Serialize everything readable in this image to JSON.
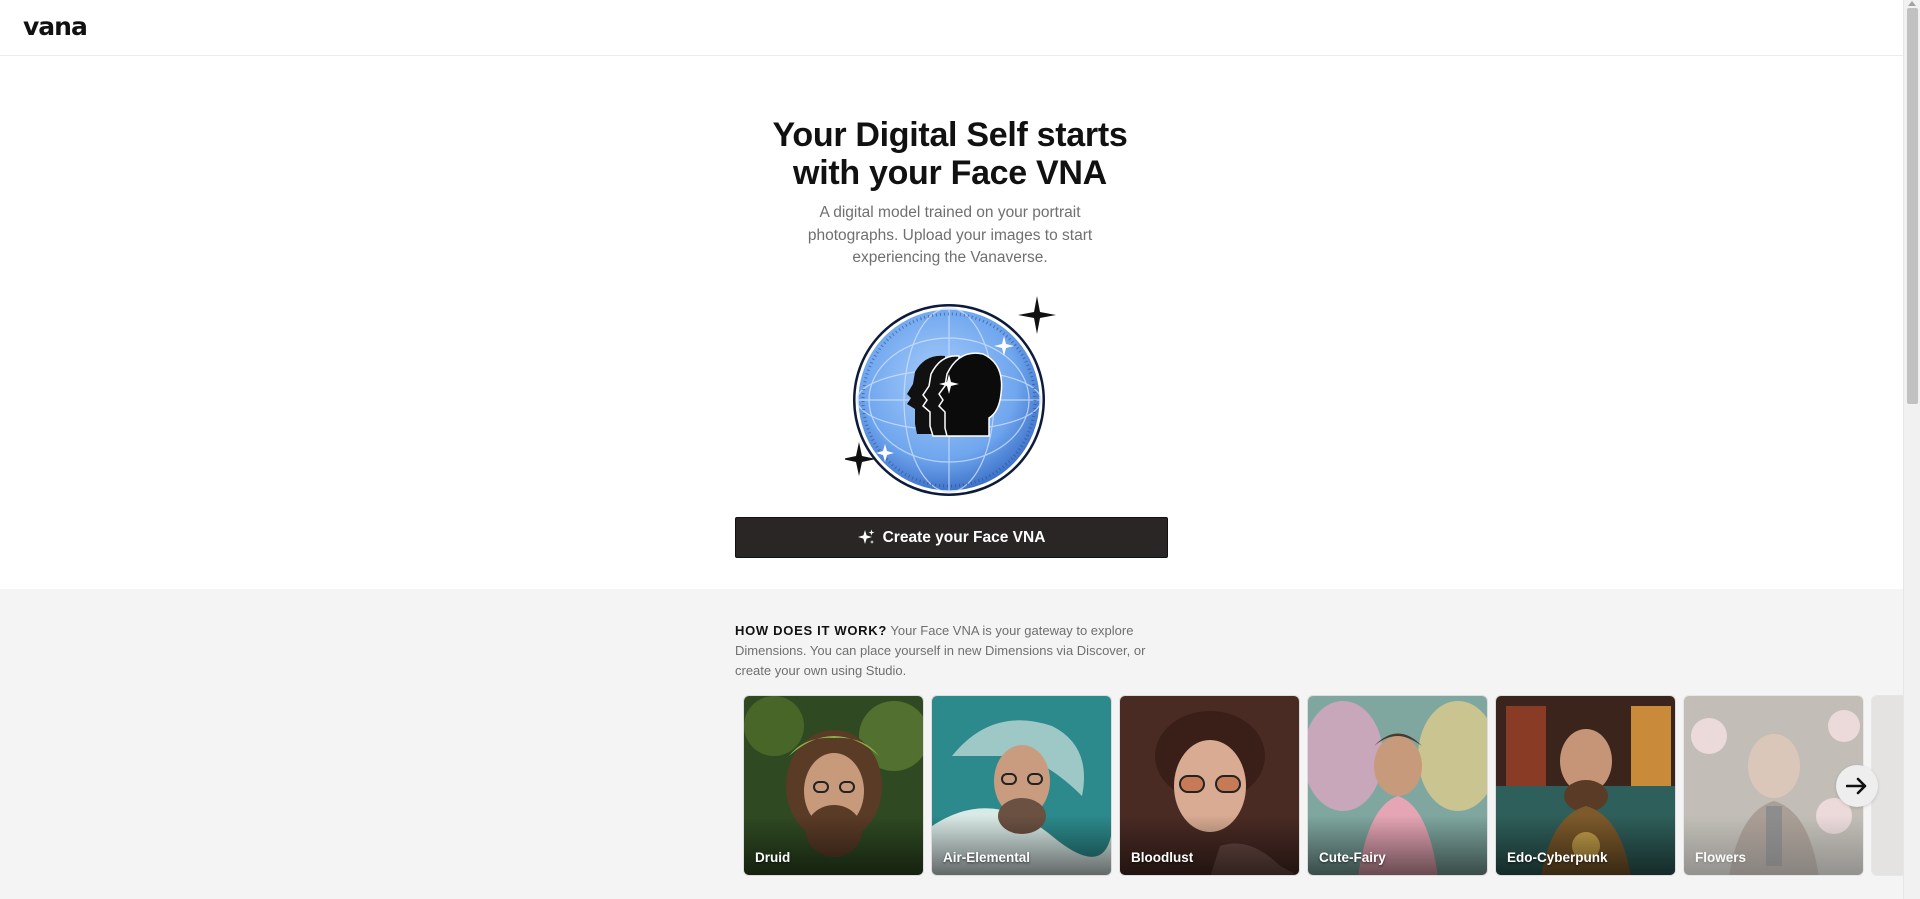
{
  "header": {
    "logo": "vana"
  },
  "hero": {
    "title_line1": "Your Digital Self starts",
    "title_line2": "with your Face VNA",
    "subtitle": "A digital model trained on your portrait photographs. Upload your images to start experiencing the Vanaverse.",
    "cta_label": "Create your Face VNA"
  },
  "how": {
    "label": "HOW DOES IT WORK?",
    "text": "Your Face VNA is your gateway to explore Dimensions. You can place yourself in new Dimensions via Discover, or create your own using Studio."
  },
  "dimensions": [
    {
      "label": "Druid",
      "bg": "#2f4a22",
      "accent": "#8ab04a"
    },
    {
      "label": "Air-Elemental",
      "bg": "#2c8a8c",
      "accent": "#d9e9e6"
    },
    {
      "label": "Bloodlust",
      "bg": "#4a2b24",
      "accent": "#c67a55"
    },
    {
      "label": "Cute-Fairy",
      "bg": "#7fa7a0",
      "accent": "#e7a6c6"
    },
    {
      "label": "Edo-Cyberpunk",
      "bg": "#3a241c",
      "accent": "#c98b3a"
    },
    {
      "label": "Flowers",
      "bg": "#9a9386",
      "accent": "#e6c6c8"
    }
  ],
  "icons": {
    "cta_icon": "sparkle-icon",
    "next_icon": "arrow-right-icon"
  },
  "colors": {
    "cta_bg": "#2a2626",
    "lower_bg": "#f4f4f4",
    "globe_blue": "#7fb2f3"
  }
}
